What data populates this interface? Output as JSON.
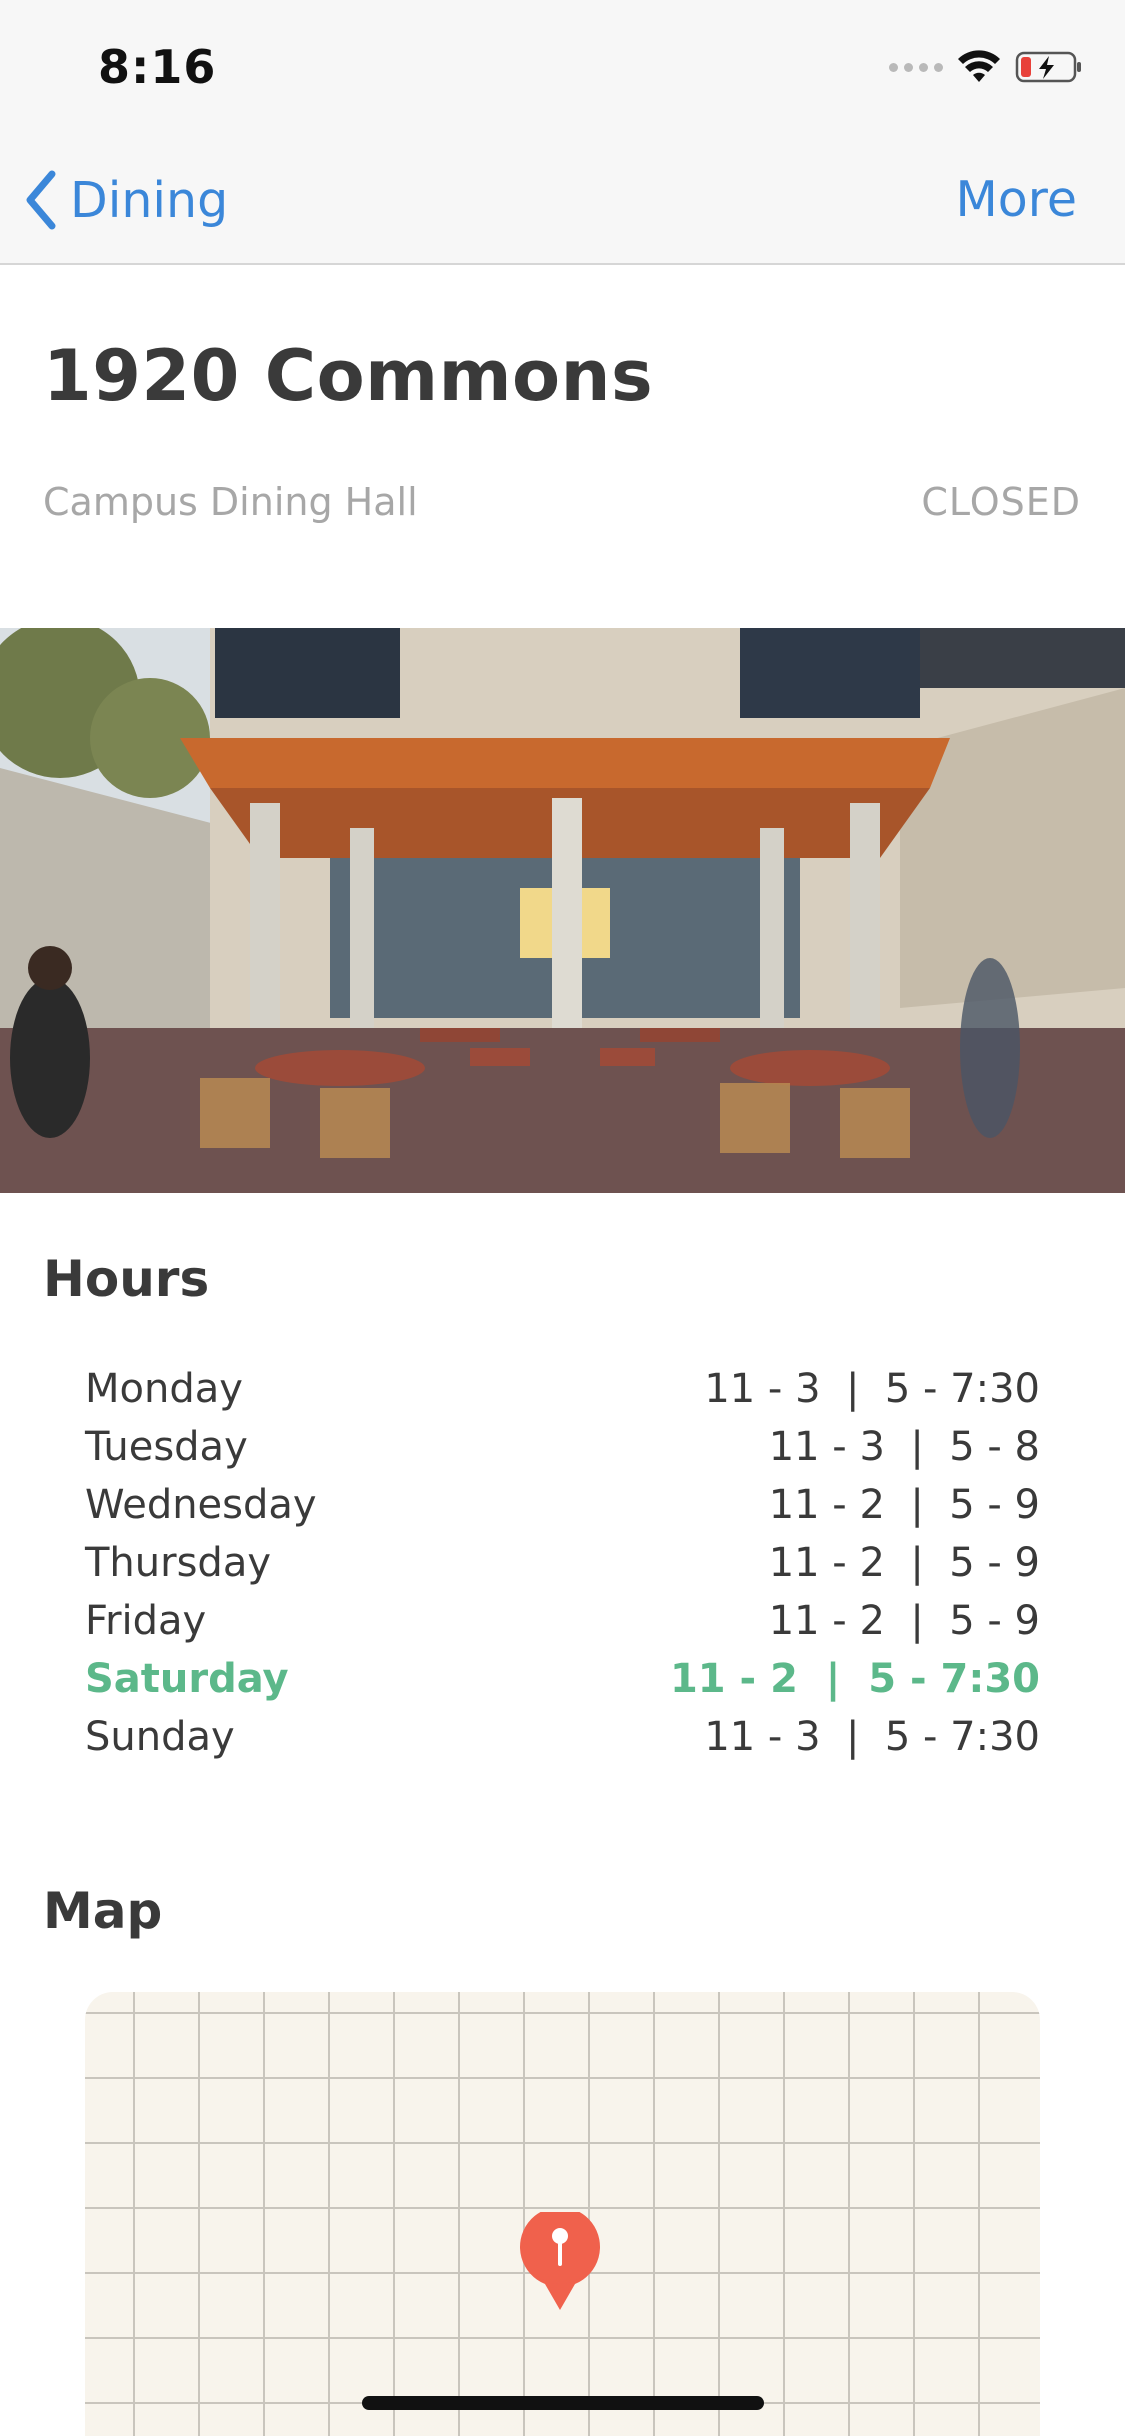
{
  "status_bar": {
    "time": "8:16"
  },
  "nav": {
    "back_label": "Dining",
    "more_label": "More",
    "accent_color": "#3b87d9"
  },
  "header": {
    "title": "1920 Commons",
    "subtitle": "Campus Dining Hall",
    "status": "CLOSED"
  },
  "hours": {
    "heading": "Hours",
    "today_color": "#5cb88a",
    "rows": [
      {
        "day": "Monday",
        "time": "11 - 3  |  5 - 7:30",
        "today": false
      },
      {
        "day": "Tuesday",
        "time": "11 - 3  |  5 - 8",
        "today": false
      },
      {
        "day": "Wednesday",
        "time": "11 - 2  |  5 - 9",
        "today": false
      },
      {
        "day": "Thursday",
        "time": "11 - 2  |  5 - 9",
        "today": false
      },
      {
        "day": "Friday",
        "time": "11 - 2  |  5 - 9",
        "today": false
      },
      {
        "day": "Saturday",
        "time": "11 - 2  |  5 - 7:30",
        "today": true
      },
      {
        "day": "Sunday",
        "time": "11 - 3  |  5 - 7:30",
        "today": false
      }
    ]
  },
  "map": {
    "heading": "Map",
    "pin_color": "#f0614c"
  },
  "icons": {
    "back": "chevron-left-icon",
    "wifi": "wifi-icon",
    "battery": "battery-charging-icon",
    "signal": "cellular-signal-icon",
    "pin": "map-pin-icon"
  }
}
